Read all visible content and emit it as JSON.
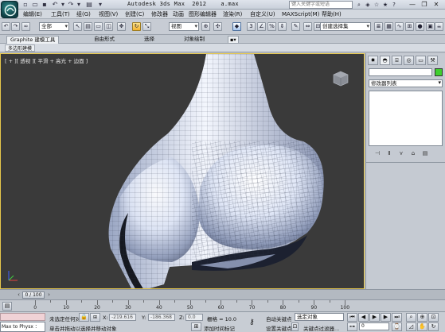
{
  "window": {
    "title": "Autodesk 3ds Max  2012    a.max",
    "search_placeholder": "键入关键字或短语",
    "controls": {
      "minimize": "—",
      "restore": "❐",
      "close": "✕"
    }
  },
  "menu": [
    "编辑(E)",
    "工具(T)",
    "组(G)",
    "视图(V)",
    "创建(C)",
    "修改器",
    "动画",
    "图形编辑器",
    "渲染(R)",
    "自定义(U)",
    "MAXScript(M)",
    "帮助(H)"
  ],
  "toolbar": {
    "filter_dropdown": "全部",
    "refcoord_dropdown": "视图",
    "selection_set_dropdown": "创建选择集",
    "snap_label": "3"
  },
  "ribbon": {
    "tabs": [
      "Graphite 建模工具",
      "自由形式",
      "选择",
      "对象绘制"
    ],
    "active_tab": 0,
    "sub_label": "多边形建模"
  },
  "viewport": {
    "label": "[ + ][ 透视 ][ 平滑 + 高光 + 边面 ]"
  },
  "command_panel": {
    "modifier_list": "修改器列表",
    "object_color": "#3ecf2e"
  },
  "timeline": {
    "frame_display": "0 / 100",
    "ticks": [
      "0",
      "10",
      "20",
      "30",
      "40",
      "50",
      "60",
      "70",
      "80",
      "90",
      "100"
    ]
  },
  "status": {
    "listener_label": "Max to Physx ：",
    "selection_text": "未选定任何对象",
    "prompt_text": "单击并拖动以选择并移动对象",
    "coord_x_label": "X:",
    "coord_x": "-219.616",
    "coord_y_label": "Y:",
    "coord_y": "-186.368",
    "coord_z_label": "Z:",
    "coord_z": "0.0",
    "grid_text": "栅格 = 10.0",
    "add_time_tag": "添加时间标记",
    "auto_key": "自动关键点",
    "set_key": "设置关键点",
    "key_filter_dropdown": "选定对象",
    "key_filters": "关键点过滤器...",
    "frame_field": "0"
  }
}
